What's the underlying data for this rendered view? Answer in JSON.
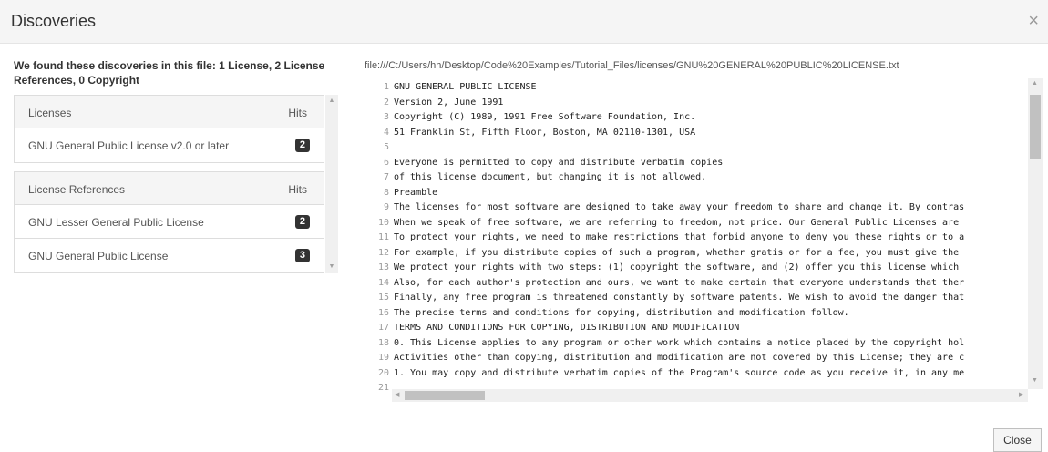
{
  "dialog": {
    "title": "Discoveries",
    "close_icon": "×"
  },
  "summary": "We found these discoveries in this file: 1 License, 2 License References, 0 Copyright",
  "licenses": {
    "header": "Licenses",
    "hits_header": "Hits",
    "items": [
      {
        "name": "GNU General Public License v2.0 or later",
        "hits": "2"
      }
    ]
  },
  "license_references": {
    "header": "License References",
    "hits_header": "Hits",
    "items": [
      {
        "name": "GNU Lesser General Public License",
        "hits": "2"
      },
      {
        "name": "GNU General Public License",
        "hits": "3"
      }
    ]
  },
  "file_path": "file:///C:/Users/hh/Desktop/Code%20Examples/Tutorial_Files/licenses/GNU%20GENERAL%20PUBLIC%20LICENSE.txt",
  "code_lines": [
    {
      "n": "1",
      "text": "GNU GENERAL PUBLIC LICENSE"
    },
    {
      "n": "2",
      "text": "Version 2, June 1991"
    },
    {
      "n": "3",
      "text": "Copyright (C) 1989, 1991 Free Software Foundation, Inc."
    },
    {
      "n": "4",
      "text": "51 Franklin St, Fifth Floor, Boston, MA  02110-1301, USA"
    },
    {
      "n": "5",
      "text": ""
    },
    {
      "n": "6",
      "text": "Everyone is permitted to copy and distribute verbatim copies"
    },
    {
      "n": "7",
      "text": "of this license document, but changing it is not allowed."
    },
    {
      "n": "8",
      "text": "Preamble"
    },
    {
      "n": "9",
      "text": "The licenses for most software are designed to take away your freedom to share and change it. By contras"
    },
    {
      "n": "10",
      "text": "When we speak of free software, we are referring to freedom, not price. Our General Public Licenses are"
    },
    {
      "n": "11",
      "text": "To protect your rights, we need to make restrictions that forbid anyone to deny you these rights or to a"
    },
    {
      "n": "12",
      "text": "For example, if you distribute copies of such a program, whether gratis or for a fee, you must give the"
    },
    {
      "n": "13",
      "text": "We protect your rights with two steps: (1) copyright the software, and (2) offer you this license which"
    },
    {
      "n": "14",
      "text": "Also, for each author's protection and ours, we want to make certain that everyone understands that ther"
    },
    {
      "n": "15",
      "text": "Finally, any free program is threatened constantly by software patents. We wish to avoid the danger that"
    },
    {
      "n": "16",
      "text": "The precise terms and conditions for copying, distribution and modification follow."
    },
    {
      "n": "17",
      "text": "TERMS AND CONDITIONS FOR COPYING, DISTRIBUTION AND MODIFICATION"
    },
    {
      "n": "18",
      "text": "0. This License applies to any program or other work which contains a notice placed by the copyright hol"
    },
    {
      "n": "19",
      "text": "Activities other than copying, distribution and modification are not covered by this License; they are c"
    },
    {
      "n": "20",
      "text": "1. You may copy and distribute verbatim copies of the Program's source code as you receive it, in any me"
    },
    {
      "n": "21",
      "text": ""
    }
  ],
  "footer": {
    "close_label": "Close"
  }
}
